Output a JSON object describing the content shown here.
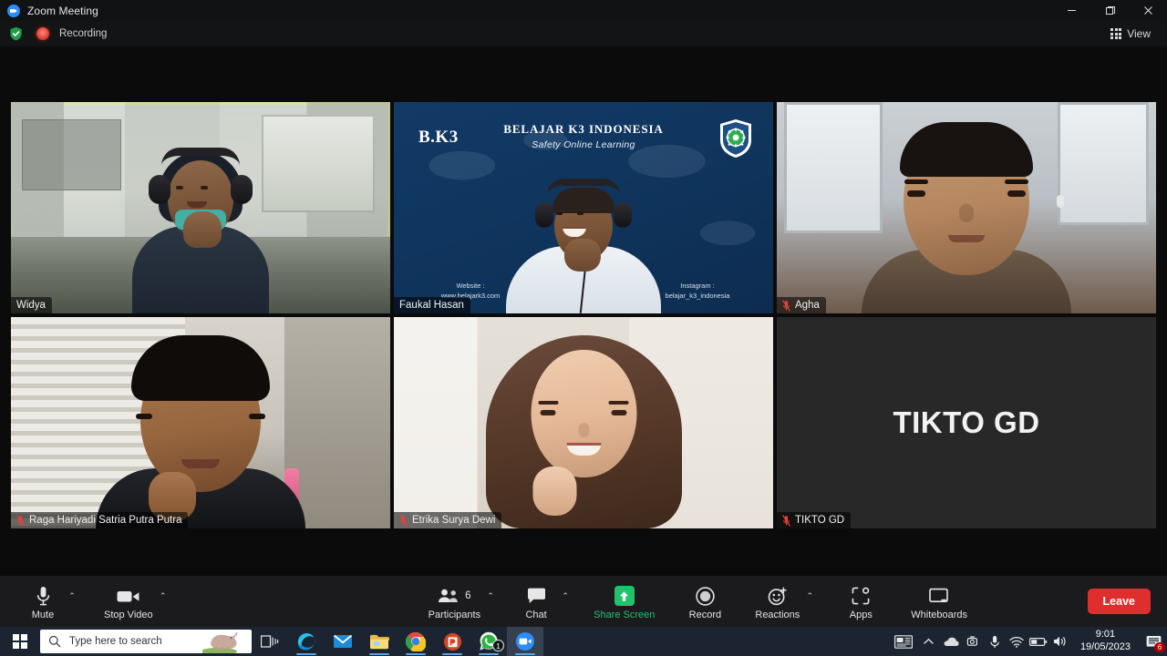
{
  "window": {
    "title": "Zoom Meeting",
    "logo_icon": "zoom-logo-icon",
    "minimize_label": "—",
    "maximize_label": "❐",
    "close_label": "✕"
  },
  "status": {
    "encryption_icon": "green-shield-check-icon",
    "recording_icon": "recording-dot-icon",
    "recording_label": "Recording",
    "view_label": "View",
    "view_icon": "grid-view-icon"
  },
  "gallery": {
    "tiles": [
      {
        "id": "widya",
        "name": "Widya",
        "muted": false,
        "active_speaker": true,
        "video_on": true,
        "placeholder_text": ""
      },
      {
        "id": "faukal-hasan",
        "name": "Faukal Hasan",
        "muted": false,
        "active_speaker": false,
        "video_on": true,
        "placeholder_text": "",
        "slide": {
          "brand": "B.K3",
          "title": "BELAJAR K3 INDONESIA",
          "subtitle": "Safety Online Learning",
          "logo_icon": "k3-shield-gear-icon",
          "website_label": "Website :",
          "website_value": "www.belajark3.com",
          "instagram_label": "Instagram :",
          "instagram_value": "belajar_k3_indonesia"
        }
      },
      {
        "id": "agha",
        "name": "Agha",
        "muted": true,
        "active_speaker": false,
        "video_on": true,
        "placeholder_text": ""
      },
      {
        "id": "raga",
        "name": "Raga Hariyadi Satria Putra Putra",
        "muted": true,
        "active_speaker": false,
        "video_on": true,
        "placeholder_text": ""
      },
      {
        "id": "etrika",
        "name": "Etrika Surya Dewi",
        "muted": true,
        "active_speaker": false,
        "video_on": true,
        "placeholder_text": ""
      },
      {
        "id": "tikto-gd",
        "name": "TIKTO GD",
        "muted": true,
        "active_speaker": false,
        "video_on": false,
        "placeholder_text": "TIKTO GD"
      }
    ]
  },
  "toolbar": {
    "mute_label": "Mute",
    "mute_icon": "microphone-icon",
    "stop_video_label": "Stop Video",
    "stop_video_icon": "video-camera-icon",
    "participants_label": "Participants",
    "participants_icon": "people-icon",
    "participants_count": "6",
    "chat_label": "Chat",
    "chat_icon": "chat-bubble-icon",
    "share_screen_label": "Share Screen",
    "share_screen_icon": "share-screen-up-arrow-icon",
    "record_label": "Record",
    "record_icon": "record-circle-icon",
    "reactions_label": "Reactions",
    "reactions_icon": "smiley-reaction-icon",
    "apps_label": "Apps",
    "apps_icon": "apps-icon",
    "whiteboards_label": "Whiteboards",
    "whiteboards_icon": "whiteboard-icon",
    "leave_label": "Leave",
    "caret_glyph": "⌃",
    "share_accent_color": "#21c26b",
    "leave_color": "#e02d2d"
  },
  "taskbar": {
    "start_icon": "windows-start-icon",
    "search_placeholder": "Type here to search",
    "search_icon": "search-icon",
    "search_decoration_icon": "rhino-image-icon",
    "apps": [
      {
        "id": "task-view",
        "icon": "task-view-icon",
        "label": "Task View"
      },
      {
        "id": "edge",
        "icon": "microsoft-edge-icon",
        "label": "Microsoft Edge"
      },
      {
        "id": "mail",
        "icon": "mail-icon",
        "label": "Mail"
      },
      {
        "id": "file-explorer",
        "icon": "file-explorer-icon",
        "label": "File Explorer"
      },
      {
        "id": "chrome",
        "icon": "google-chrome-icon",
        "label": "Google Chrome"
      },
      {
        "id": "powerpoint",
        "icon": "powerpoint-icon",
        "label": "PowerPoint"
      },
      {
        "id": "whatsapp",
        "icon": "whatsapp-icon",
        "label": "WhatsApp",
        "badge": "1"
      },
      {
        "id": "zoom",
        "icon": "zoom-app-icon",
        "label": "Zoom"
      }
    ],
    "tray": {
      "news_icon": "news-and-interests-icon",
      "chevron_icon": "show-hidden-icons-icon",
      "onedrive_icon": "onedrive-cloud-icon",
      "camera_icon": "camera-in-use-icon",
      "mic_icon": "microphone-in-use-icon",
      "network_icon": "wifi-icon",
      "battery_icon": "battery-icon",
      "volume_icon": "speaker-volume-icon",
      "time": "9:01",
      "date": "19/05/2023",
      "action_center_icon": "action-center-icon",
      "notification_count": "6"
    }
  }
}
